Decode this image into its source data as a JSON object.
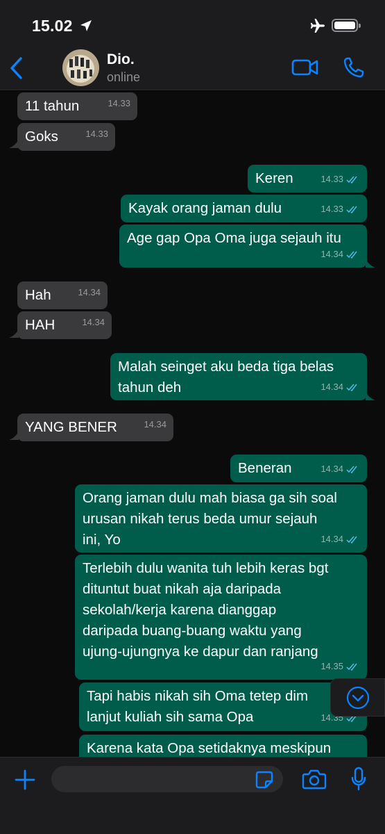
{
  "status_bar": {
    "time": "15.02"
  },
  "header": {
    "contact_name": "Dio.",
    "contact_status": "online"
  },
  "messages": [
    {
      "dir": "in",
      "text": "11 tahun",
      "time": "14.33"
    },
    {
      "dir": "in",
      "text": "Goks",
      "time": "14.33"
    },
    {
      "dir": "out",
      "text": "Keren",
      "time": "14.33",
      "read": true
    },
    {
      "dir": "out",
      "text": "Kayak orang jaman dulu",
      "time": "14.33",
      "read": true
    },
    {
      "dir": "out",
      "text": "Age gap Opa Oma juga sejauh itu",
      "time": "14.34",
      "read": true
    },
    {
      "dir": "in",
      "text": "Hah",
      "time": "14.34"
    },
    {
      "dir": "in",
      "text": "HAH",
      "time": "14.34"
    },
    {
      "dir": "out",
      "lines": [
        "Malah seinget aku beda tiga belas",
        "tahun deh"
      ],
      "time": "14.34",
      "read": true
    },
    {
      "dir": "in",
      "text": "YANG BENER",
      "time": "14.34"
    },
    {
      "dir": "out",
      "text": "Beneran",
      "time": "14.34",
      "read": true
    },
    {
      "dir": "out",
      "lines": [
        "Orang jaman dulu mah biasa ga sih soal",
        "urusan nikah terus beda umur sejauh",
        "ini, Yo"
      ],
      "time": "14.34",
      "read": true
    },
    {
      "dir": "out",
      "lines": [
        "Terlebih dulu wanita tuh lebih keras bgt",
        "dituntut buat nikah aja daripada",
        "sekolah/kerja karena dianggap",
        "daripada buang-buang waktu yang",
        "ujung-ujungnya ke dapur dan ranjang"
      ],
      "time": "14.35",
      "read": true
    },
    {
      "dir": "out",
      "lines": [
        "Tapi habis nikah sih Oma tetep dim",
        "lanjut kuliah sih sama Opa"
      ],
      "time": "14.35",
      "read": true
    },
    {
      "dir": "out",
      "lines": [
        "Karena kata Opa setidaknya meskipun"
      ],
      "time": "",
      "read": false
    }
  ],
  "icons": {
    "location": "location-arrow-icon",
    "airplane": "airplane-icon",
    "battery": "battery-icon",
    "back": "chevron-left-icon",
    "video": "video-camera-icon",
    "phone": "phone-icon",
    "scroll_down": "chevron-down-circle-icon",
    "plus": "plus-icon",
    "sticker": "sticker-icon",
    "camera": "camera-icon",
    "mic": "microphone-icon"
  },
  "colors": {
    "accent": "#0a84ff",
    "bubble_out": "#005c4b",
    "bubble_in": "#3a3a3c",
    "read_ticks": "#53bdeb"
  }
}
